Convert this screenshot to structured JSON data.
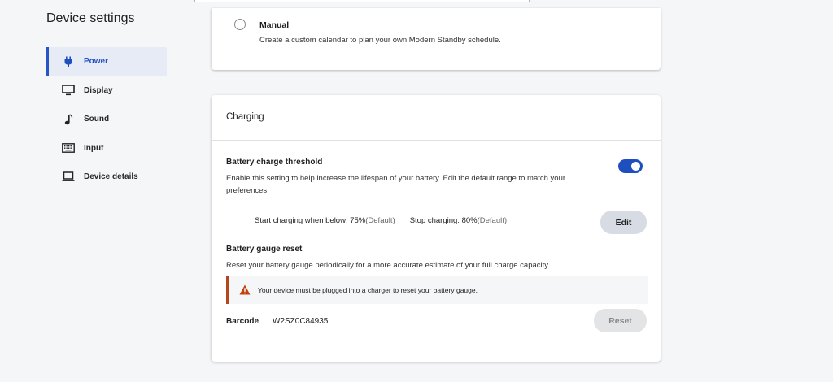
{
  "sidebar": {
    "title": "Device settings",
    "items": [
      {
        "label": "Power",
        "icon": "plug-icon",
        "active": true
      },
      {
        "label": "Display",
        "icon": "monitor-icon"
      },
      {
        "label": "Sound",
        "icon": "music-note-icon"
      },
      {
        "label": "Input",
        "icon": "keyboard-icon"
      },
      {
        "label": "Device details",
        "icon": "laptop-icon"
      }
    ]
  },
  "manual": {
    "title": "Manual",
    "description": "Create a custom calendar to plan your own Modern Standby schedule."
  },
  "charging": {
    "title": "Charging",
    "threshold": {
      "title": "Battery charge threshold",
      "description_line1": "Enable this setting to help increase the lifespan of your battery. Edit the default range to match your",
      "description_line2": "preferences.",
      "enabled": true,
      "start_label": "Start charging when below: 75%",
      "start_default": "(Default)",
      "stop_label": "Stop charging: 80%",
      "stop_default": "(Default)",
      "edit_label": "Edit"
    },
    "gauge": {
      "title": "Battery gauge reset",
      "description": "Reset your battery gauge periodically for a more accurate estimate of your full charge capacity.",
      "warning": "Your device must be plugged into a charger to reset your battery gauge.",
      "barcode_label": "Barcode",
      "barcode_value": "W2SZ0C84935",
      "reset_label": "Reset"
    }
  },
  "colors": {
    "accent": "#1f4fbf",
    "warning": "#b5451b"
  }
}
